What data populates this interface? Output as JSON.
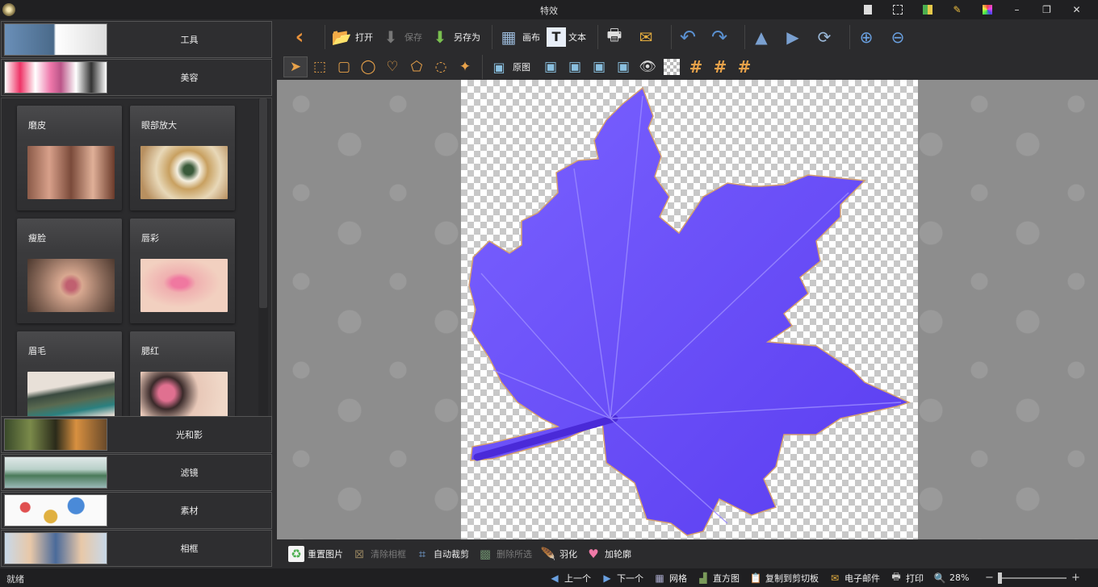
{
  "window": {
    "title": "特效"
  },
  "sidebar": {
    "top_sections": [
      {
        "label": "工具"
      },
      {
        "label": "美容"
      }
    ],
    "tiles": [
      {
        "label": "磨皮"
      },
      {
        "label": "眼部放大"
      },
      {
        "label": "瘦脸"
      },
      {
        "label": "唇彩"
      },
      {
        "label": "眉毛"
      },
      {
        "label": "腮红"
      }
    ],
    "bottom_sections": [
      {
        "label": "光和影"
      },
      {
        "label": "滤镜"
      },
      {
        "label": "素材"
      },
      {
        "label": "相框"
      }
    ]
  },
  "toolbar": {
    "open": "打开",
    "save": "保存",
    "save_as": "另存为",
    "canvas": "画布",
    "text": "文本"
  },
  "toolbar2": {
    "original": "原图"
  },
  "bottom_actions": {
    "reset": "重置图片",
    "clear_frame": "清除相框",
    "auto_crop": "自动裁剪",
    "delete_selection": "删除所选",
    "feather": "羽化",
    "outline": "加轮廓"
  },
  "status": {
    "ready": "就绪",
    "prev": "上一个",
    "next": "下一个",
    "grid": "网格",
    "histogram": "直方图",
    "copy_clipboard": "复制到剪切板",
    "email": "电子邮件",
    "print": "打印",
    "zoom": "28%"
  },
  "colors": {
    "accent_orange": "#e8a24a",
    "leaf_purple": "#6a4cff",
    "background": "#2b2b2d"
  }
}
